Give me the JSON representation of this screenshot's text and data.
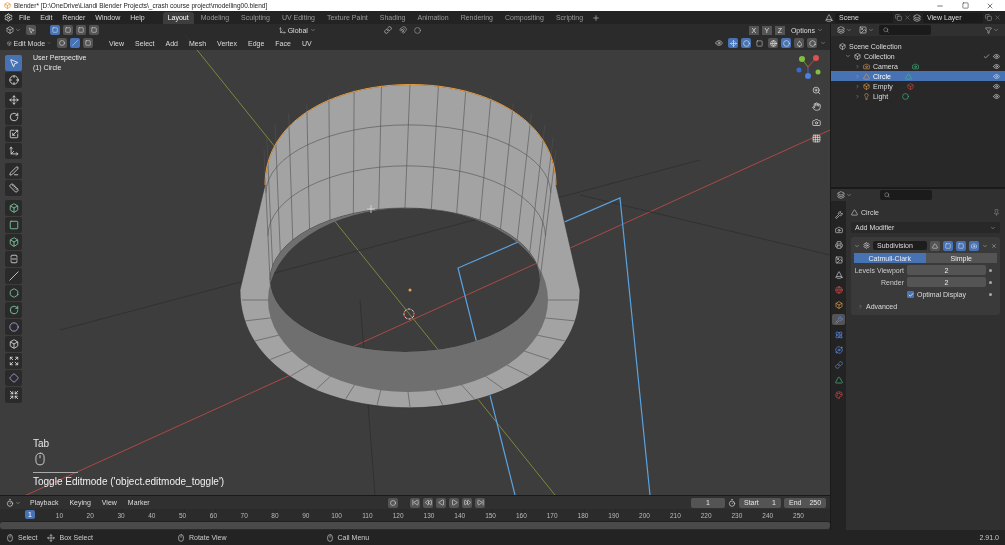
{
  "window": {
    "title": "Blender* [D:\\OneDrive\\Liandi Blender Projects\\_crash course project\\modelling00.blend]"
  },
  "top_bar": {
    "menus": [
      "File",
      "Edit",
      "Render",
      "Window",
      "Help"
    ],
    "workspaces": [
      {
        "label": "Layout",
        "selected": true
      },
      {
        "label": "Modeling",
        "selected": false
      },
      {
        "label": "Sculpting",
        "selected": false
      },
      {
        "label": "UV Editing",
        "selected": false
      },
      {
        "label": "Texture Paint",
        "selected": false
      },
      {
        "label": "Shading",
        "selected": false
      },
      {
        "label": "Animation",
        "selected": false
      },
      {
        "label": "Rendering",
        "selected": false
      },
      {
        "label": "Compositing",
        "selected": false
      },
      {
        "label": "Scripting",
        "selected": false
      }
    ],
    "scene": "Scene",
    "view_layer": "View Layer"
  },
  "viewport_header": {
    "select_box_modes": [
      {
        "selected": true
      },
      {
        "selected": false
      },
      {
        "selected": false
      },
      {
        "selected": false
      }
    ],
    "orientation": "Global",
    "axes": [
      "X",
      "Y",
      "Z"
    ],
    "options": "Options",
    "mode": "Edit Mode",
    "mesh_select_modes": [
      {
        "kind": "vertex",
        "selected": false
      },
      {
        "kind": "edge",
        "selected": true
      },
      {
        "kind": "face",
        "selected": false
      }
    ],
    "menus": [
      "View",
      "Select",
      "Add",
      "Mesh",
      "Vertex",
      "Edge",
      "Face",
      "UV"
    ],
    "shading_modes": [
      {
        "kind": "wireframe",
        "selected": false
      },
      {
        "kind": "solid",
        "selected": true
      },
      {
        "kind": "material",
        "selected": false
      },
      {
        "kind": "rendered",
        "selected": false
      }
    ]
  },
  "viewport": {
    "view_name": "User Perspective",
    "object": "(1) Circle",
    "last_operator": {
      "key": "Tab",
      "description": "Toggle Editmode ('object.editmode_toggle')"
    }
  },
  "tools": [
    {
      "kind": "select",
      "selected": true
    },
    {
      "kind": "cursor",
      "selected": false
    },
    {
      "kind": "move",
      "selected": false
    },
    {
      "kind": "rotate",
      "selected": false
    },
    {
      "kind": "scale",
      "selected": false
    },
    {
      "kind": "transform",
      "selected": false
    },
    {
      "kind": "annotate",
      "selected": false
    },
    {
      "kind": "measure",
      "selected": false
    },
    {
      "kind": "extrude",
      "selected": false
    },
    {
      "kind": "inset",
      "selected": false
    },
    {
      "kind": "bevel",
      "selected": false
    },
    {
      "kind": "loop-cut",
      "selected": false
    },
    {
      "kind": "knife",
      "selected": false
    },
    {
      "kind": "poly-build",
      "selected": false
    },
    {
      "kind": "spin",
      "selected": false
    },
    {
      "kind": "smooth",
      "selected": false
    },
    {
      "kind": "edge-slide",
      "selected": false
    },
    {
      "kind": "shrink",
      "selected": false
    },
    {
      "kind": "shear",
      "selected": false
    },
    {
      "kind": "rip",
      "selected": false
    }
  ],
  "outliner": {
    "root": "Scene Collection",
    "collections": [
      {
        "label": "Collection",
        "expanded": true,
        "children": [
          {
            "label": "Camera",
            "kind": "camera",
            "selected": false,
            "expanded": false
          },
          {
            "label": "Circle",
            "kind": "mesh",
            "selected": true,
            "expanded": false
          },
          {
            "label": "Empty",
            "kind": "empty",
            "selected": false,
            "expanded": false
          },
          {
            "label": "Light",
            "kind": "light",
            "selected": false,
            "expanded": false
          }
        ]
      }
    ]
  },
  "properties": {
    "tabs": [
      {
        "kind": "tool",
        "selected": false
      },
      {
        "kind": "render",
        "selected": false
      },
      {
        "kind": "output",
        "selected": false
      },
      {
        "kind": "view-layer",
        "selected": false
      },
      {
        "kind": "scene",
        "selected": false
      },
      {
        "kind": "world",
        "selected": false
      },
      {
        "kind": "object",
        "selected": false
      },
      {
        "kind": "modifiers",
        "selected": true
      },
      {
        "kind": "particles",
        "selected": false
      },
      {
        "kind": "physics",
        "selected": false
      },
      {
        "kind": "constraints",
        "selected": false
      },
      {
        "kind": "data",
        "selected": false
      },
      {
        "kind": "material",
        "selected": false
      }
    ],
    "object": "Circle",
    "add_modifier": "Add Modifier",
    "modifier": {
      "name": "Subdivision",
      "types": [
        {
          "label": "Catmull-Clark",
          "selected": true
        },
        {
          "label": "Simple",
          "selected": false
        }
      ],
      "fields": [
        {
          "label": "Levels Viewport",
          "value": "2"
        },
        {
          "label": "Render",
          "value": "2"
        }
      ],
      "optimal_display": {
        "label": "Optimal Display",
        "checked": true
      },
      "advanced": {
        "label": "Advanced",
        "expanded": false
      }
    }
  },
  "timeline": {
    "menus": [
      "Playback",
      "Keying",
      "View",
      "Marker"
    ],
    "current_frame": "1",
    "start_label": "Start",
    "start": "1",
    "end_label": "End",
    "end": "250",
    "playhead": "1",
    "ruler": [
      "10",
      "20",
      "30",
      "40",
      "50",
      "60",
      "70",
      "80",
      "90",
      "100",
      "110",
      "120",
      "130",
      "140",
      "150",
      "160",
      "170",
      "180",
      "190",
      "200",
      "210",
      "220",
      "230",
      "240",
      "250"
    ]
  },
  "status_bar": {
    "hints": [
      {
        "kind": "left-click",
        "label": "Select"
      },
      {
        "kind": "left-drag",
        "label": "Box Select"
      },
      {
        "kind": "middle-drag",
        "label": "Rotate View"
      },
      {
        "kind": "right-click",
        "label": "Call Menu"
      }
    ],
    "version": "2.91.0"
  }
}
